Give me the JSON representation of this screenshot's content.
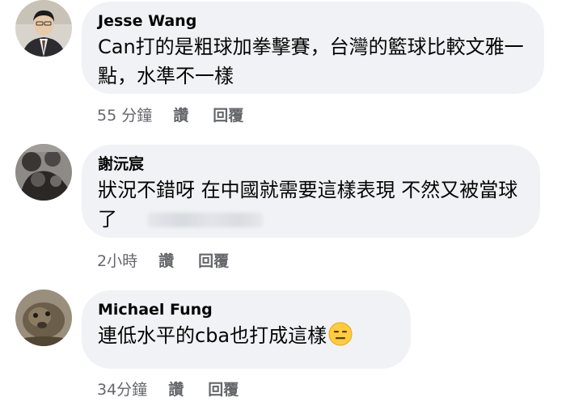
{
  "comments": [
    {
      "author": "Jesse Wang",
      "text": "Can打的是粗球加拳擊賽，台灣的籃球比較文雅一點，水準不一樣",
      "time": "55 分鐘",
      "like": "讚",
      "reply": "回覆",
      "avatar_icon": "profile-photo-man-in-suit"
    },
    {
      "author": "謝沅宸",
      "text": "狀況不錯呀  在中國就需要這樣表現 不然又被當球了",
      "time": "2小時",
      "like": "讚",
      "reply": "回覆",
      "avatar_icon": "profile-photo-dark-figure"
    },
    {
      "author": "Michael Fung",
      "text": "連低水平的cba也打成這樣",
      "emoji": "expressionless-face-emoji",
      "time": "34分鐘",
      "like": "讚",
      "reply": "回覆",
      "avatar_icon": "profile-photo-animal"
    }
  ],
  "colors": {
    "bubble": "#f0f2f5",
    "meta_text": "#65676b",
    "text": "#050505"
  }
}
